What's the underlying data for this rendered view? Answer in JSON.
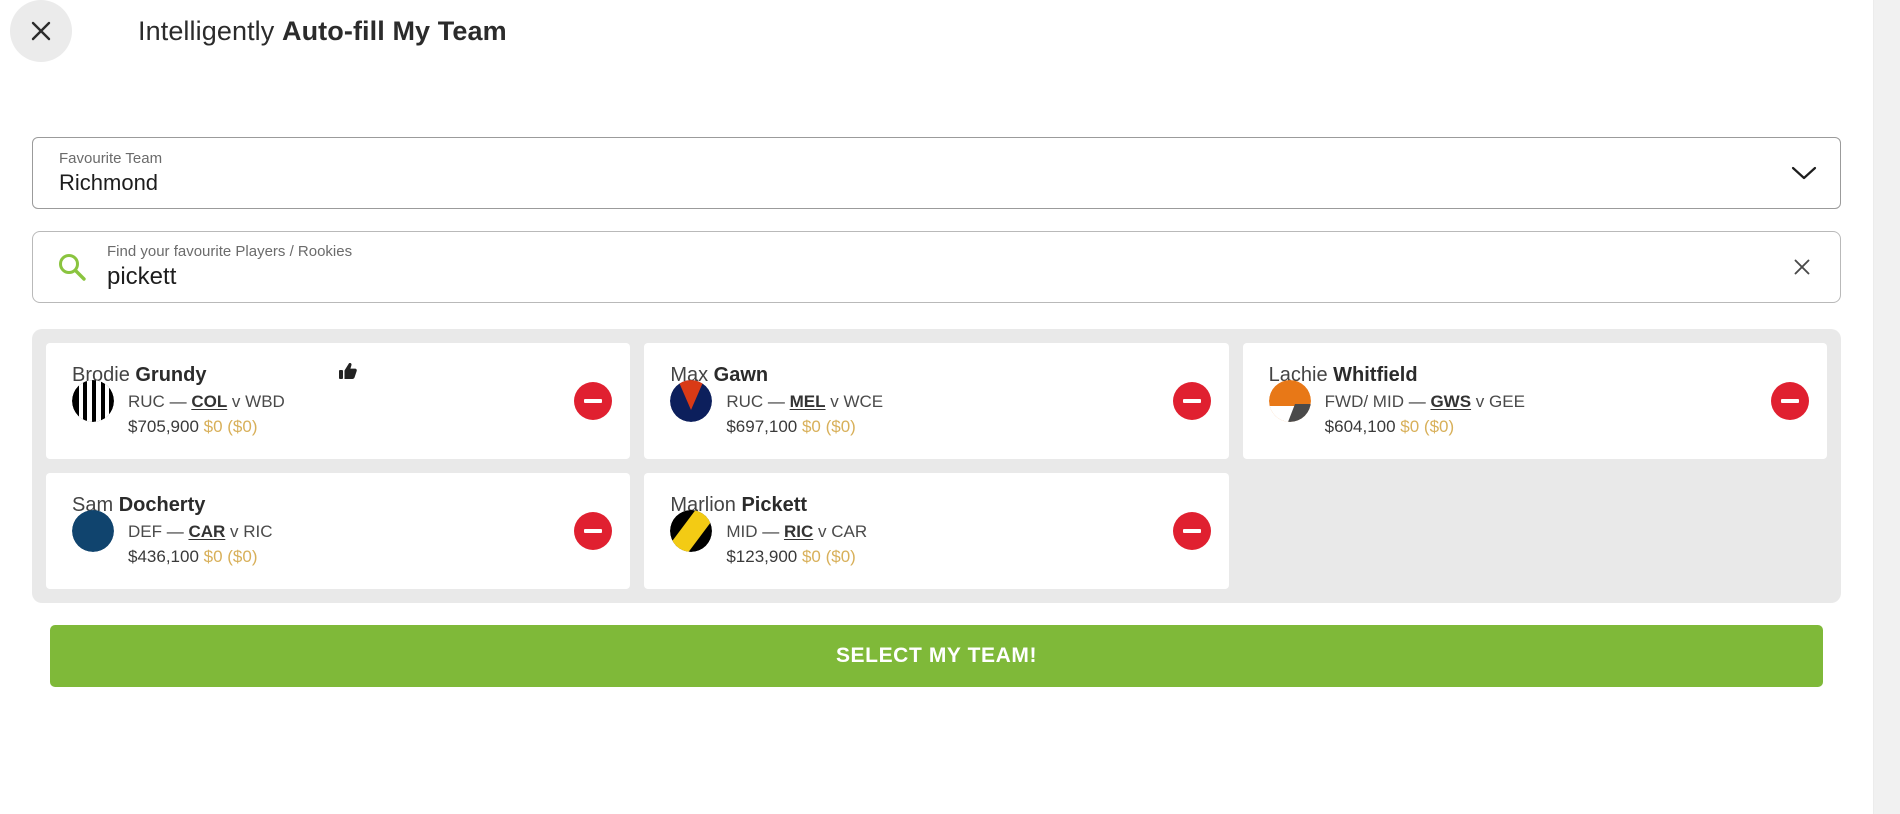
{
  "header": {
    "close_icon": "close-icon",
    "title_prefix": "Intelligently ",
    "title_bold": "Auto-fill My Team"
  },
  "favourite_team": {
    "label": "Favourite Team",
    "value": "Richmond",
    "chevron_icon": "chevron-down-icon"
  },
  "search": {
    "icon": "search-icon",
    "placeholder": "Find your favourite Players / Rookies",
    "value": "pickett",
    "clear_icon": "close-icon"
  },
  "results": [
    {
      "first_name": "Brodie ",
      "last_name": "Grundy",
      "position": "RUC",
      "dash": "—",
      "team": "COL",
      "versus_prefix": " v ",
      "opponent": "WBD",
      "price": "$705,900",
      "delta": "$0 ($0)",
      "crest": "collingwood",
      "liked": true,
      "like_icon": "thumbs-up-icon",
      "remove_icon": "minus-circle-icon"
    },
    {
      "first_name": "Max ",
      "last_name": "Gawn",
      "position": "RUC",
      "dash": "—",
      "team": "MEL",
      "versus_prefix": " v ",
      "opponent": "WCE",
      "price": "$697,100",
      "delta": "$0 ($0)",
      "crest": "melbourne",
      "liked": false,
      "like_icon": "thumbs-up-icon",
      "remove_icon": "minus-circle-icon"
    },
    {
      "first_name": "Lachie ",
      "last_name": "Whitfield",
      "position": "FWD/ MID",
      "dash": "—",
      "team": "GWS",
      "versus_prefix": " v ",
      "opponent": "GEE",
      "price": "$604,100",
      "delta": "$0 ($0)",
      "crest": "gws",
      "liked": false,
      "like_icon": "thumbs-up-icon",
      "remove_icon": "minus-circle-icon"
    },
    {
      "first_name": "Sam ",
      "last_name": "Docherty",
      "position": "DEF",
      "dash": "—",
      "team": "CAR",
      "versus_prefix": " v ",
      "opponent": "RIC",
      "price": "$436,100",
      "delta": "$0 ($0)",
      "crest": "carlton",
      "liked": false,
      "like_icon": "thumbs-up-icon",
      "remove_icon": "minus-circle-icon"
    },
    {
      "first_name": "Marlion ",
      "last_name": "Pickett",
      "position": "MID",
      "dash": "—",
      "team": "RIC",
      "versus_prefix": " v ",
      "opponent": "CAR",
      "price": "$123,900",
      "delta": "$0 ($0)",
      "crest": "richmond",
      "liked": false,
      "like_icon": "thumbs-up-icon",
      "remove_icon": "minus-circle-icon"
    }
  ],
  "submit": {
    "label": "SELECT MY TEAM!"
  },
  "colors": {
    "accent_green": "#7fb939",
    "remove_red": "#e02030",
    "delta_gold": "#d8b05a",
    "panel_grey": "#e9e9e9"
  }
}
